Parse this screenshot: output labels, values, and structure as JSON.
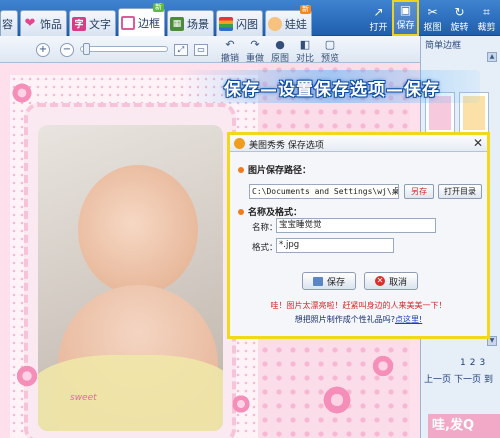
{
  "colors": {
    "toolbar": "#2f72c2",
    "highlight": "#f0d81a",
    "accent_pink": "#f58fba",
    "banner_outline": "#0c4da2"
  },
  "tabs": [
    {
      "label": "容",
      "icon": "none"
    },
    {
      "label": "饰品",
      "icon": "heart-icon"
    },
    {
      "label": "文字",
      "icon": "text-icon"
    },
    {
      "label": "边框",
      "icon": "frame-icon",
      "badge": "新",
      "active": true
    },
    {
      "label": "场景",
      "icon": "scene-icon"
    },
    {
      "label": "闪图",
      "icon": "flash-icon"
    },
    {
      "label": "娃娃",
      "icon": "doll-icon",
      "badge": "新"
    }
  ],
  "top_tools": [
    {
      "label": "打开",
      "icon": "open-icon"
    },
    {
      "label": "保存",
      "icon": "save-icon",
      "highlighted": true
    },
    {
      "label": "抠图",
      "icon": "cutout-icon"
    },
    {
      "label": "旋转",
      "icon": "rotate-icon"
    },
    {
      "label": "裁剪",
      "icon": "crop-icon"
    }
  ],
  "subtools": {
    "zoom_in": "+",
    "zoom_out": "−",
    "buttons": [
      {
        "label": "撤销",
        "icon": "undo-icon"
      },
      {
        "label": "重做",
        "icon": "redo-icon"
      },
      {
        "label": "原图",
        "icon": "original-icon"
      },
      {
        "label": "对比",
        "icon": "compare-icon"
      },
      {
        "label": "预览",
        "icon": "preview-icon"
      }
    ]
  },
  "banner": "保存—设置保存选项—保存",
  "canvas": {
    "watermark": "sweet"
  },
  "right_panel": {
    "title": "简单边框",
    "pages": [
      "1",
      "2",
      "3"
    ],
    "prev": "上一页",
    "next": "下一页",
    "extra": "到",
    "bottom_text": "哇,发Q"
  },
  "dialog": {
    "title": "美图秀秀 保存选项",
    "path_section": "图片保存路径：",
    "path_value": "C:\\Documents and Settings\\wj\\桌",
    "btn_save_as": "另存",
    "btn_open_dir": "打开目录",
    "name_section": "名称及格式：",
    "name_label": "名称：",
    "name_value": "宝宝睡觉觉",
    "format_label": "格式：",
    "format_value": "*.jpg",
    "btn_save": "保存",
    "btn_cancel": "取消",
    "tip_red": "哇！图片太漂亮啦！赶紧叫身边的人来美美一下！",
    "tip_blue": "想把照片制作成个性礼品吗?",
    "tip_link": "点这里!"
  }
}
